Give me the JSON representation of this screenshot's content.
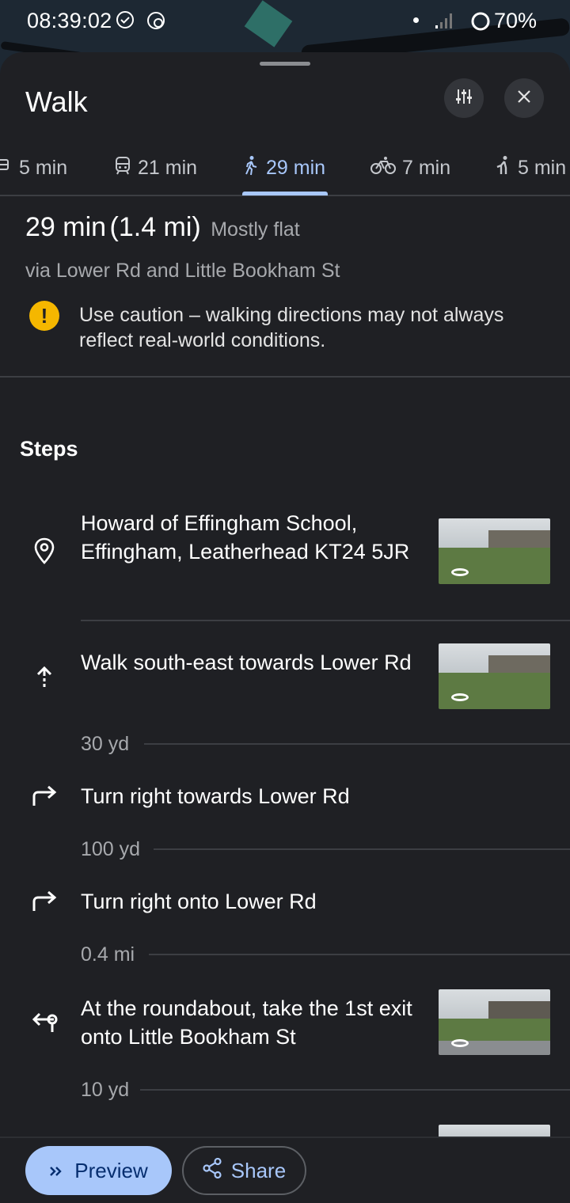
{
  "status_bar": {
    "time": "08:39:02",
    "battery": "70%"
  },
  "sheet": {
    "title": "Walk"
  },
  "modes": [
    {
      "icon": "car-icon",
      "label": "5 min"
    },
    {
      "icon": "transit-icon",
      "label": "21 min"
    },
    {
      "icon": "walk-icon",
      "label": "29 min",
      "active": true
    },
    {
      "icon": "bike-icon",
      "label": "7 min"
    },
    {
      "icon": "ride-icon",
      "label": "5 min"
    }
  ],
  "summary": {
    "duration": "29 min",
    "distance": "(1.4 mi)",
    "terrain": "Mostly flat",
    "via": "via Lower Rd and Little Bookham St",
    "caution": "Use caution – walking directions may not always reflect real-world conditions."
  },
  "steps_heading": "Steps",
  "steps": [
    {
      "icon": "place-pin-icon",
      "text": "Howard of Effingham School, Effingham, Leatherhead KT24 5JR",
      "has_thumb": true
    },
    {
      "icon": "arrow-up-icon",
      "text": "Walk south-east towards Lower Rd",
      "distance": "30 yd",
      "has_thumb": true
    },
    {
      "icon": "turn-right-icon",
      "text": "Turn right towards Lower Rd",
      "distance": "100 yd"
    },
    {
      "icon": "turn-right-icon",
      "text": "Turn right onto Lower Rd",
      "distance": "0.4 mi"
    },
    {
      "icon": "roundabout-icon",
      "text": "At the roundabout, take the 1st exit onto Little Bookham St",
      "distance": "10 yd",
      "has_thumb": true
    }
  ],
  "actions": {
    "preview": "Preview",
    "share": "Share"
  },
  "colors": {
    "background": "#1f2024",
    "accent": "#a8c7fa",
    "caution": "#f5b700"
  }
}
